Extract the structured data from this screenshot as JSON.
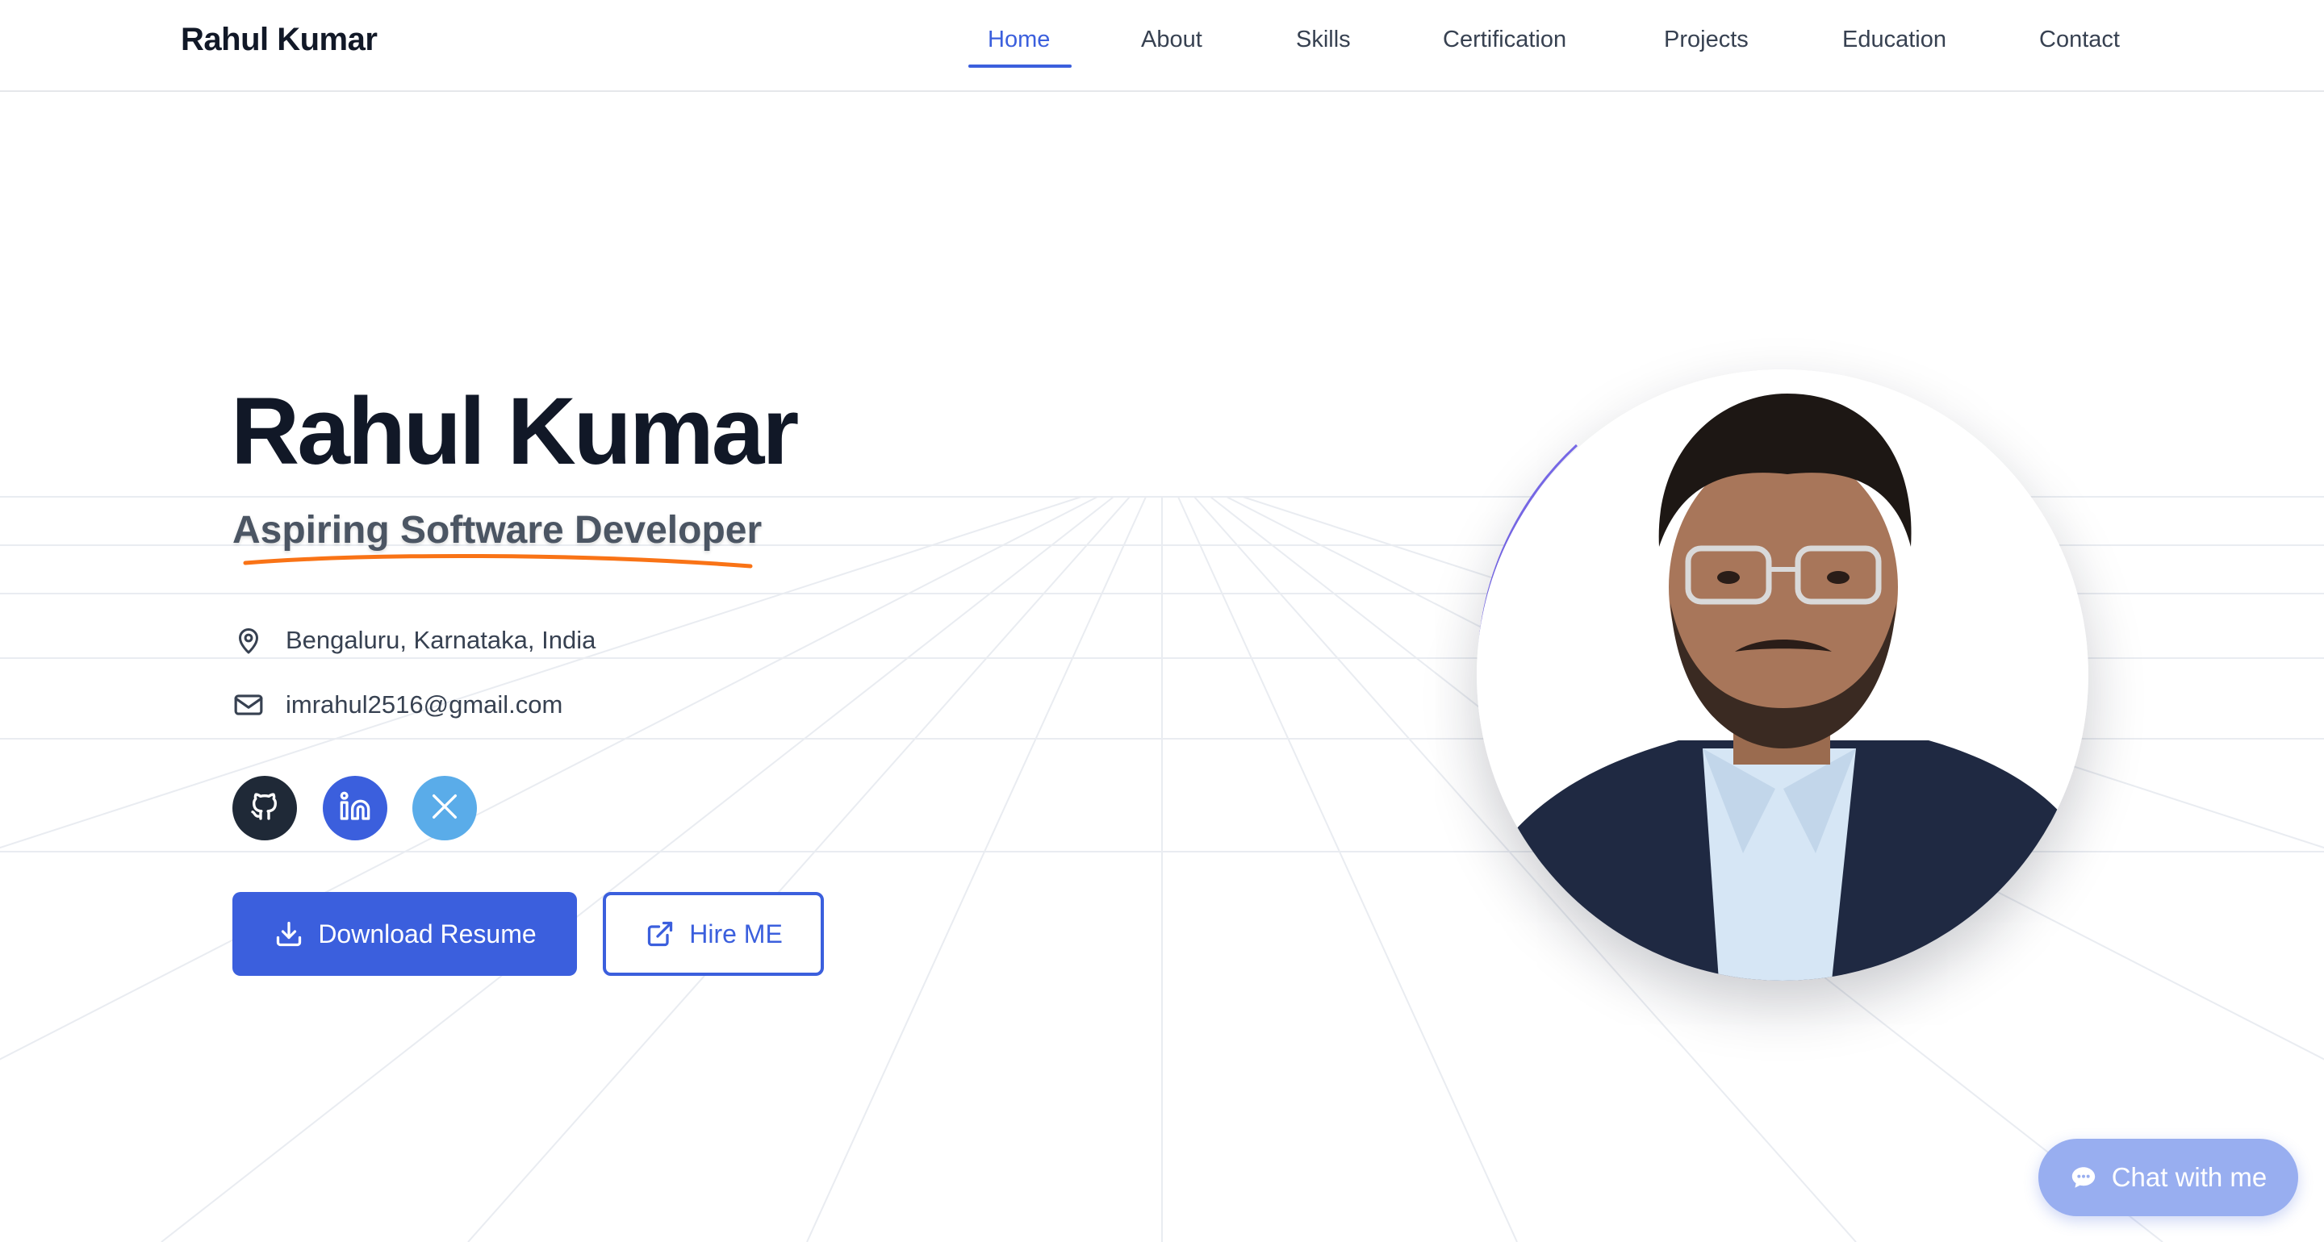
{
  "nav": {
    "brand": "Rahul Kumar",
    "links": [
      "Home",
      "About",
      "Skills",
      "Certification",
      "Projects",
      "Education",
      "Contact"
    ],
    "active": "Home"
  },
  "hero": {
    "name": "Rahul Kumar",
    "role": "Aspiring Software Developer",
    "location": "Bengaluru, Karnataka, India",
    "email": "imrahul2516@gmail.com"
  },
  "social": {
    "icons": [
      "github-icon",
      "linkedin-icon",
      "x-twitter-icon"
    ]
  },
  "buttons": {
    "download": "Download Resume",
    "hire": "Hire ME"
  },
  "chat": {
    "label": "Chat with me"
  },
  "colors": {
    "accent": "#3b5fdd",
    "underline": "#f97316",
    "chat": "#98aef0",
    "ring": "#7c6cf0"
  }
}
